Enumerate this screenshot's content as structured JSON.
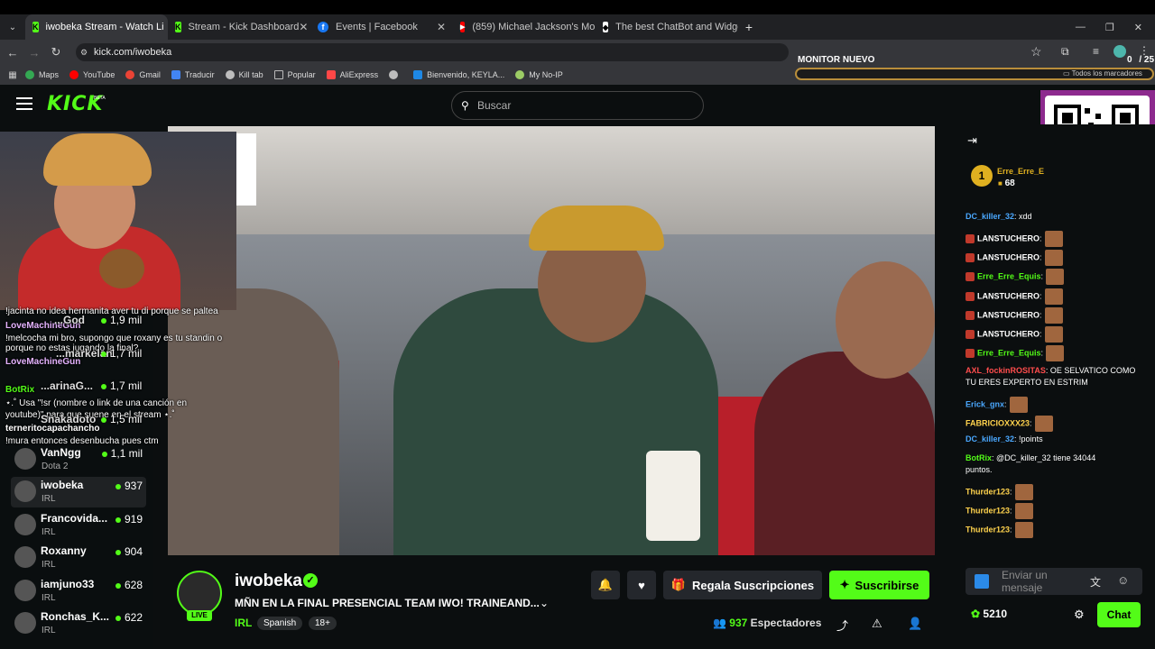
{
  "browser": {
    "tabs": [
      {
        "title": "iwobeka Stream - Watch Li",
        "favicon": "kick-icon",
        "active": true,
        "sound": true
      },
      {
        "title": "Stream - Kick Dashboard",
        "favicon": "kick-icon",
        "active": false
      },
      {
        "title": "Events | Facebook",
        "favicon": "facebook-icon",
        "active": false
      },
      {
        "title": "(859) Michael Jackson's Mo",
        "favicon": "youtube-icon",
        "active": false,
        "sound": true
      },
      {
        "title": "The best ChatBot and Widgets",
        "favicon": "botrix-icon",
        "active": false
      }
    ],
    "new_tab": "+",
    "url": "kick.com/iwobeka",
    "bookmarks": [
      {
        "label": "Maps",
        "color": "#34a853"
      },
      {
        "label": "YouTube",
        "color": "#ff0000"
      },
      {
        "label": "Gmail",
        "color": "#ea4335"
      },
      {
        "label": "Traducir",
        "color": "#4285f4"
      },
      {
        "label": "Kill tab",
        "color": "#bdbdbd"
      },
      {
        "label": "Popular",
        "color": "#888888"
      },
      {
        "label": "AliExpress",
        "color": "#ff4747"
      },
      {
        "label": "",
        "color": "#bdbdbd"
      },
      {
        "label": "Bienvenido, KEYLA...",
        "color": "#1e88e5"
      },
      {
        "label": "My No-IP",
        "color": "#9ccc65"
      }
    ],
    "all_bookmarks": "Todos los marcadores",
    "monitor_label": "MONITOR NUEVO",
    "counter_left": "0",
    "counter_right": "/ 25"
  },
  "kick": {
    "logo": "KICK",
    "beta": "BETA",
    "search_placeholder": "Buscar",
    "accent": "#53fc18"
  },
  "sidebar": {
    "channels": [
      {
        "name": "VanNgg",
        "category": "Dota 2",
        "viewers": "1,1 mil"
      },
      {
        "name": "iwobeka",
        "category": "IRL",
        "viewers": "937",
        "active": true
      },
      {
        "name": "Francovida...",
        "category": "IRL",
        "viewers": "919"
      },
      {
        "name": "Roxanny",
        "category": "IRL",
        "viewers": "904"
      },
      {
        "name": "iamjuno33",
        "category": "IRL",
        "viewers": "628"
      },
      {
        "name": "Ronchas_K...",
        "category": "IRL",
        "viewers": "622"
      }
    ],
    "hidden_channels": [
      {
        "name": "...God",
        "viewers": "1,9 mil"
      },
      {
        "name": "...markelan",
        "viewers": "1,7 mil"
      },
      {
        "name": "...arinaG...",
        "viewers": "1,7 mil"
      },
      {
        "name": "Snakadoto",
        "viewers": "1,5 mil"
      }
    ]
  },
  "overlay_chat": [
    {
      "text": "!jacinta no idea hermanita aver tu di porque se paltea"
    },
    {
      "user": "LoveMachineGun",
      "text": ""
    },
    {
      "text": "!melcocha mi bro, supongo que roxany es tu standin o"
    },
    {
      "text": "porque no estas jugando la final?"
    },
    {
      "user": "LoveMachineGun",
      "text": ""
    },
    {
      "user": "BotRix",
      "text": ""
    },
    {
      "text": "⋆.˚ Usa \"!sr (nombre o link de una canción en"
    },
    {
      "text": "youtube)\" para que suene en el stream ⋆.˚"
    },
    {
      "user": "terneritocapachancho",
      "text": ""
    },
    {
      "text": "!mura entonces desenbucha pues ctm"
    }
  ],
  "stream": {
    "streamer": "iwobeka",
    "title": "MÑN EN LA FINAL PRESENCIAL TEAM IWO! TRAINEAND...",
    "category": "IRL",
    "tags": [
      "Spanish",
      "18+"
    ],
    "live_label": "LIVE",
    "gift_label": "Regala Suscripciones",
    "subscribe_label": "Suscribirse",
    "viewers": "937",
    "viewers_label": "Espectadores"
  },
  "chat": {
    "top_rank": "1",
    "top_user": "Erre_Erre_E",
    "top_count": "68",
    "messages": [
      {
        "user": "DC_killer_32",
        "color": "#4aa8ff",
        "text": ": xdd"
      },
      {
        "user": "LANSTUCHERO",
        "color": "#ffffff",
        "text": ":",
        "emote": true,
        "badge": true
      },
      {
        "user": "LANSTUCHERO",
        "color": "#ffffff",
        "text": ":",
        "emote": true,
        "badge": true
      },
      {
        "user": "Erre_Erre_Equis",
        "color": "#53fc18",
        "text": ":",
        "emote": true,
        "badge": true
      },
      {
        "user": "LANSTUCHERO",
        "color": "#ffffff",
        "text": ":",
        "emote": true,
        "badge": true
      },
      {
        "user": "LANSTUCHERO",
        "color": "#ffffff",
        "text": ":",
        "emote": true,
        "badge": true
      },
      {
        "user": "LANSTUCHERO",
        "color": "#ffffff",
        "text": ":",
        "emote": true,
        "badge": true
      },
      {
        "user": "Erre_Erre_Equis",
        "color": "#53fc18",
        "text": ":",
        "emote": true,
        "badge": true
      },
      {
        "user": "AXL_fockinROSITAS",
        "color": "#ff4d4d",
        "text": ": OE SELVATICO COMO"
      },
      {
        "text": "TU ERES EXPERTO EN ESTRIM"
      },
      {
        "user": "Erick_gnx",
        "color": "#4aa8ff",
        "text": ":",
        "emote": true
      },
      {
        "user": "FABRICIOXXX23",
        "color": "#ffd34d",
        "text": ":",
        "emote": true
      },
      {
        "user": "DC_killer_32",
        "color": "#4aa8ff",
        "text": ": !points"
      },
      {
        "user": "BotRix",
        "color": "#53fc18",
        "text": ": @DC_killer_32 tiene 34044"
      },
      {
        "text": "puntos."
      },
      {
        "user": "Thurder123",
        "color": "#ffd34d",
        "text": ":",
        "emote": true
      },
      {
        "user": "Thurder123",
        "color": "#ffd34d",
        "text": ":",
        "emote": true
      },
      {
        "user": "Thurder123",
        "color": "#ffd34d",
        "text": ":",
        "emote": true
      }
    ],
    "input_placeholder": "Enviar un mensaje",
    "points": "5210",
    "chat_button": "Chat"
  }
}
